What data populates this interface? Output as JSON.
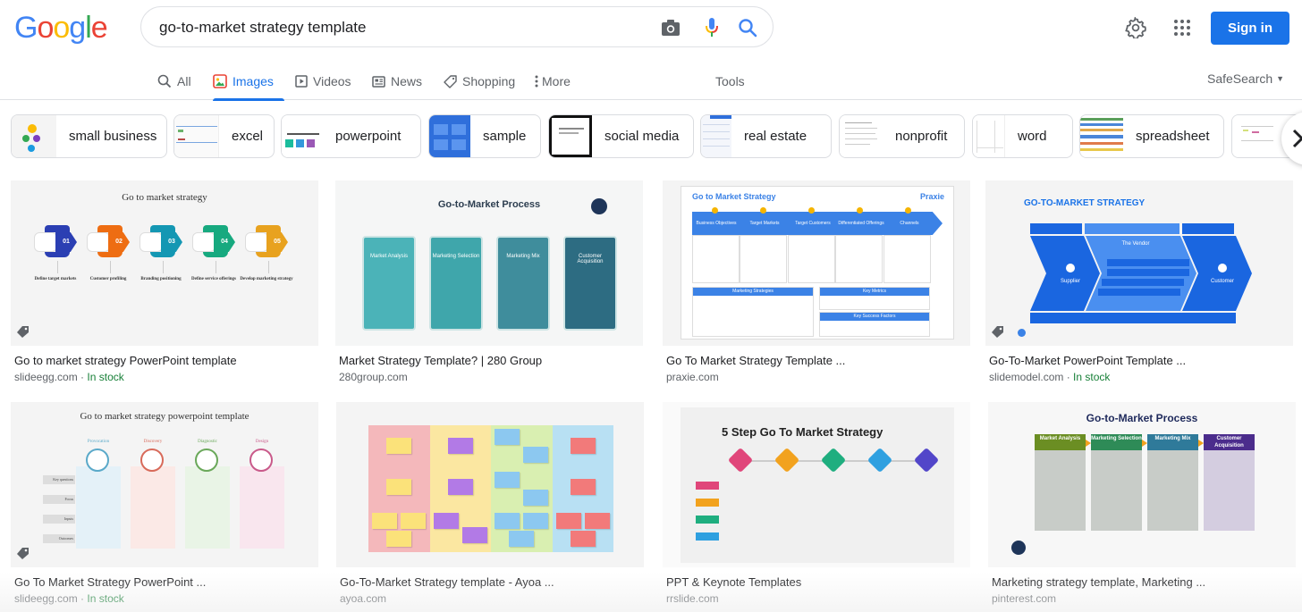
{
  "logo": {
    "letters": [
      "G",
      "o",
      "o",
      "g",
      "l",
      "e"
    ],
    "colors": [
      "#4285f4",
      "#ea4335",
      "#fbbc05",
      "#4285f4",
      "#34a853",
      "#ea4335"
    ]
  },
  "search": {
    "query": "go-to-market strategy template",
    "camera_icon": "camera-icon",
    "mic_icon": "mic-icon",
    "search_icon": "search-icon"
  },
  "header": {
    "settings_icon": "gear-icon",
    "apps_icon": "apps-grid-icon",
    "sign_in_label": "Sign in"
  },
  "tabs": [
    {
      "label": "All",
      "icon": "search-icon",
      "active": false
    },
    {
      "label": "Images",
      "icon": "image-icon",
      "active": true
    },
    {
      "label": "Videos",
      "icon": "play-icon",
      "active": false
    },
    {
      "label": "News",
      "icon": "newspaper-icon",
      "active": false
    },
    {
      "label": "Shopping",
      "icon": "tag-icon",
      "active": false
    },
    {
      "label": "More",
      "icon": "more-vert-icon",
      "active": false
    }
  ],
  "tools_label": "Tools",
  "safesearch_label": "SafeSearch",
  "chips": [
    {
      "label": "small business"
    },
    {
      "label": "excel"
    },
    {
      "label": "powerpoint"
    },
    {
      "label": "sample"
    },
    {
      "label": "social media"
    },
    {
      "label": "real estate"
    },
    {
      "label": "nonprofit"
    },
    {
      "label": "word"
    },
    {
      "label": "spreadsheet"
    }
  ],
  "results": [
    {
      "title": "Go to market strategy PowerPoint template",
      "source": "slideegg.com",
      "stock": "In stock",
      "image_caption": "Go to market strategy",
      "steps": [
        "01",
        "02",
        "03",
        "04",
        "05"
      ],
      "step_labels": [
        "Define target markets",
        "Customer profiling",
        "Branding positioning",
        "Define service offerings",
        "Develop marketing strategy"
      ]
    },
    {
      "title": "Market Strategy Template? | 280 Group",
      "source": "280group.com",
      "stock": "",
      "image_caption": "Go-to-Market Process",
      "boxes": [
        "Market Analysis",
        "Marketing Selection",
        "Marketing Mix",
        "Customer Acquisition"
      ]
    },
    {
      "title": "Go To Market Strategy Template ...",
      "source": "praxie.com",
      "stock": "",
      "image_caption": "Go to Market Strategy",
      "brand": "Praxie",
      "steps": [
        "Business Objectives",
        "Target Markets",
        "Target Customers",
        "Differentiated Offerings",
        "Channels"
      ],
      "sections": [
        "Marketing Strategies",
        "Key Metrics",
        "Key Success Factors"
      ]
    },
    {
      "title": "Go-To-Market PowerPoint Template ...",
      "source": "slidemodel.com",
      "stock": "In stock",
      "image_caption": "GO-TO-MARKET STRATEGY",
      "labels": [
        "Supplier",
        "The Vendor",
        "Customer"
      ]
    },
    {
      "title": "Go To Market Strategy PowerPoint ...",
      "source": "slideegg.com",
      "stock": "In stock",
      "image_caption": "Go to market strategy powerpoint template",
      "columns": [
        "Provocation",
        "Discovery",
        "Diagnostic",
        "Design"
      ],
      "rows": [
        "Key questions",
        "Focus",
        "Inputs",
        "Outcomes"
      ]
    },
    {
      "title": "Go-To-Market Strategy template - Ayoa ...",
      "source": "ayoa.com",
      "stock": "",
      "image_caption": ""
    },
    {
      "title": "PPT & Keynote Templates",
      "source": "rrslide.com",
      "stock": "",
      "image_caption": "5 Step Go To Market Strategy"
    },
    {
      "title": "Marketing strategy template, Marketing ...",
      "source": "pinterest.com",
      "stock": "",
      "image_caption": "Go-to-Market Process",
      "boxes": [
        "Market Analysis",
        "Marketing Selection",
        "Marketing Mix",
        "Customer Acquisition"
      ]
    }
  ],
  "colors": {
    "accent": "#1a73e8",
    "in_stock": "#188038",
    "text_secondary": "#5f6368"
  }
}
